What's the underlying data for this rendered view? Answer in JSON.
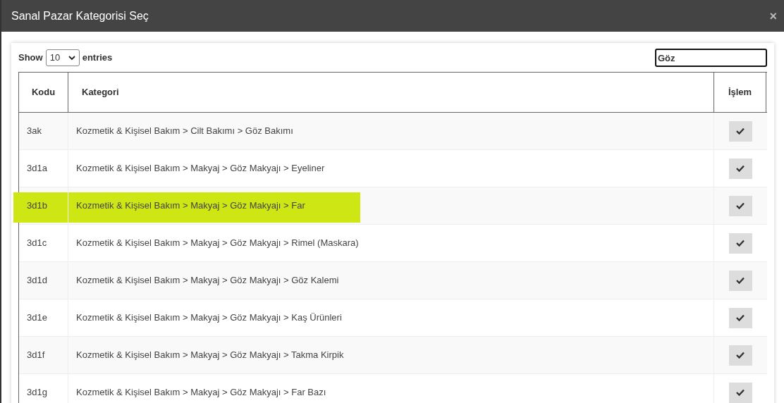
{
  "dialog": {
    "title": "Sanal Pazar Kategorisi Seç",
    "close": "×"
  },
  "length_menu": {
    "before": "Show",
    "value": "10",
    "after": "entries"
  },
  "search": {
    "value": "Göz"
  },
  "table": {
    "columns": [
      "Kodu",
      "Kategori",
      "İşlem"
    ],
    "rows": [
      {
        "code": "3ak",
        "category": "Kozmetik & Kişisel Bakım > Cilt Bakımı > Göz Bakımı",
        "highlighted": false
      },
      {
        "code": "3d1a",
        "category": "Kozmetik & Kişisel Bakım > Makyaj > Göz Makyajı > Eyeliner",
        "highlighted": false
      },
      {
        "code": "3d1b",
        "category": "Kozmetik & Kişisel Bakım > Makyaj > Göz Makyajı > Far",
        "highlighted": true
      },
      {
        "code": "3d1c",
        "category": "Kozmetik & Kişisel Bakım > Makyaj > Göz Makyajı > Rimel (Maskara)",
        "highlighted": false
      },
      {
        "code": "3d1d",
        "category": "Kozmetik & Kişisel Bakım > Makyaj > Göz Makyajı > Göz Kalemi",
        "highlighted": false
      },
      {
        "code": "3d1e",
        "category": "Kozmetik & Kişisel Bakım > Makyaj > Göz Makyajı > Kaş Ürünleri",
        "highlighted": false
      },
      {
        "code": "3d1f",
        "category": "Kozmetik & Kişisel Bakım > Makyaj > Göz Makyajı > Takma Kirpik",
        "highlighted": false
      },
      {
        "code": "3d1g",
        "category": "Kozmetik & Kişisel Bakım > Makyaj > Göz Makyajı > Far Bazı",
        "highlighted": false
      }
    ]
  }
}
